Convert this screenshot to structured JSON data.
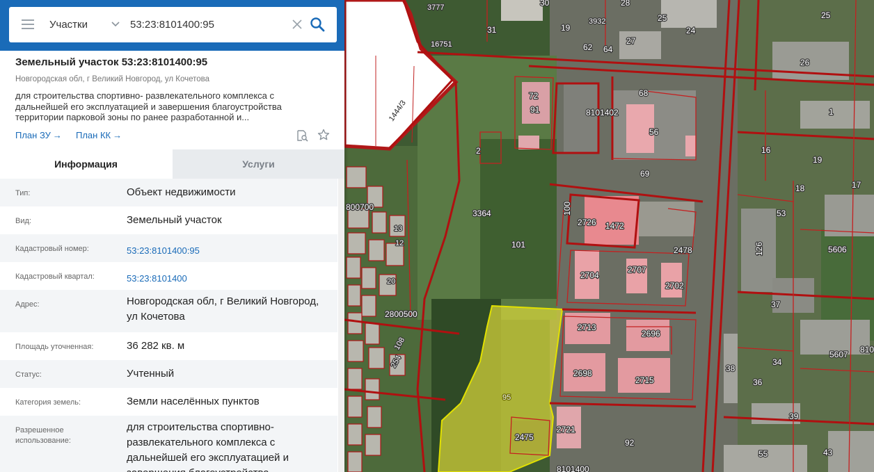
{
  "search": {
    "layer": "Участки",
    "query": "53:23:8101400:95"
  },
  "parcel": {
    "title": "Земельный участок 53:23:8101400:95",
    "address_line": "Новгородская обл, г Великий Новгород, ул Кочетова",
    "description": "для строительства спортивно- развлекательного комплекса с дальнейшей его эксплуатацией и завершения благоустройства территории парковой зоны по ранее разработанной и...",
    "plan_zu": "План ЗУ",
    "plan_kk": "План КК"
  },
  "tabs": {
    "info": "Информация",
    "services": "Услуги"
  },
  "properties": [
    {
      "key": "Тип:",
      "value": "Объект недвижимости"
    },
    {
      "key": "Вид:",
      "value": "Земельный участок"
    },
    {
      "key": "Кадастровый номер:",
      "value": "53:23:8101400:95"
    },
    {
      "key": "Кадастровый квартал:",
      "value": "53:23:8101400"
    },
    {
      "key": "Адрес:",
      "value": "Новгородская обл, г Великий Новгород, ул Кочетова"
    },
    {
      "key": "Площадь уточненная:",
      "value": "36 282 кв. м"
    },
    {
      "key": "Статус:",
      "value": "Учтенный"
    },
    {
      "key": "Категория земель:",
      "value": "Земли населённых пунктов"
    },
    {
      "key": "Разрешенное использование:",
      "value": "для строительства спортивно-развлекательного комплекса с дальнейшей его эксплуатацией и завершения благоустройства"
    }
  ],
  "map_labels": {
    "parcel_selected": "95",
    "l3777": "3777",
    "l30": "30",
    "l3932": "3932",
    "l28": "28",
    "l25a": "25",
    "l24": "24",
    "l25b": "25",
    "l31": "31",
    "l19a": "19",
    "l16751": "16751",
    "l62": "62",
    "l64": "64",
    "l27": "27",
    "l26": "26",
    "l1444_3": "1444/3",
    "l72": "72",
    "l91": "91",
    "l8101402": "8101402",
    "l68": "68",
    "l56": "56",
    "l1": "1",
    "l16": "16",
    "l19b": "19",
    "l2": "2",
    "l69": "69",
    "l18": "18",
    "l17": "17",
    "l800700": "800700",
    "l3364": "3364",
    "l100": "100",
    "l2726": "2726",
    "l1472": "1472",
    "l53": "53",
    "l5606": "5606",
    "l101": "101",
    "l2478": "2478",
    "l126": "126",
    "l2704": "2704",
    "l2707": "2707",
    "l2702": "2702",
    "l37": "37",
    "l2800500": "2800500",
    "l2713": "2713",
    "l2696": "2696",
    "l34": "34",
    "l5607": "5607",
    "l38": "38",
    "l2698": "2698",
    "l2715": "2715",
    "l36": "36",
    "l39": "39",
    "l2475": "2475",
    "l2721": "2721",
    "l92": "92",
    "l55": "55",
    "l43": "43",
    "l8101400": "8101400",
    "l13": "13",
    "l12": "12",
    "l20": "20",
    "l108": "108",
    "l254": "254",
    "l810": "810"
  }
}
